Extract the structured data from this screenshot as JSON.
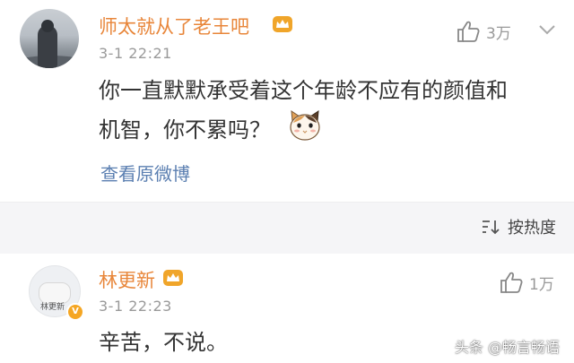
{
  "comment1": {
    "username": "师太就从了老王吧",
    "time": "3-1 22:21",
    "likes": "3万",
    "text_line1": "你一直默默承受着这个年龄不应有的颜值和",
    "text_line2": "机智，你不累吗？",
    "view_original": "查看原微博"
  },
  "sort": {
    "label": "按热度"
  },
  "comment2": {
    "username": "林更新",
    "time": "3-1 22:23",
    "likes": "1万",
    "text": "辛苦，不说。",
    "avatar_tag": "林更新"
  },
  "watermark": "头条 @畅言畅语",
  "colors": {
    "username": "#e8863a",
    "link": "#5b7fb1",
    "meta": "#9a9a9a",
    "band": "#f5f5f7",
    "crown": "#f0a52a"
  }
}
